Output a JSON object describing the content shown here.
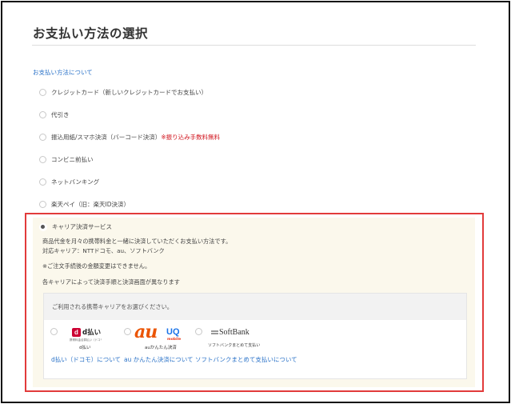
{
  "page_title": "お支払い方法の選択",
  "about_link": "お支払い方法について",
  "options": [
    {
      "label": "クレジットカード（新しいクレジットカードでお支払い）",
      "note": ""
    },
    {
      "label": "代引き",
      "note": ""
    },
    {
      "label": "振込用紙/スマホ決済（バーコード決済）",
      "note": "※振り込み手数料無料"
    },
    {
      "label": "コンビニ前払い",
      "note": ""
    },
    {
      "label": "ネットバンキング",
      "note": ""
    },
    {
      "label": "楽天ペイ（旧：楽天ID決済）",
      "note": ""
    }
  ],
  "selected_option": {
    "label": "キャリア決済サービス",
    "description_1": "商品代金を月々の携帯料金と一緒に決済していただくお支払い方法です。",
    "description_2": "対応キャリア：NTTドコモ、au、ソフトバンク",
    "warning": "※ご注文手続後の金額変更はできません。",
    "flow_note": "各キャリアによって決済手順と決済画面が異なります"
  },
  "carrier_select": {
    "prompt": "ご利用される携帯キャリアをお選びください。",
    "carriers": [
      {
        "name": "docomo",
        "logo_text": "d払い",
        "logo_badge": "d",
        "logo_sub": "携帯料金合算払い（ドコモ払い）",
        "logo_caption": "d払い",
        "link": "d払い（ドコモ）について"
      },
      {
        "name": "au",
        "logo_text": "au",
        "logo_uq": "UQ",
        "logo_mobile": "mobile",
        "logo_caption": "auかんたん決済",
        "link": "au かんたん決済について"
      },
      {
        "name": "softbank",
        "logo_text": "SoftBank",
        "logo_caption": "ソフトバンクまとめて支払い",
        "link": "ソフトバンクまとめて支払いについて"
      }
    ]
  },
  "colors": {
    "link": "#2a72c8",
    "warning": "#d0121b",
    "highlight_border": "#e23b3b",
    "panel_bg": "#fbf8ec",
    "docomo_red": "#cc0033",
    "au_orange": "#eb5505"
  }
}
